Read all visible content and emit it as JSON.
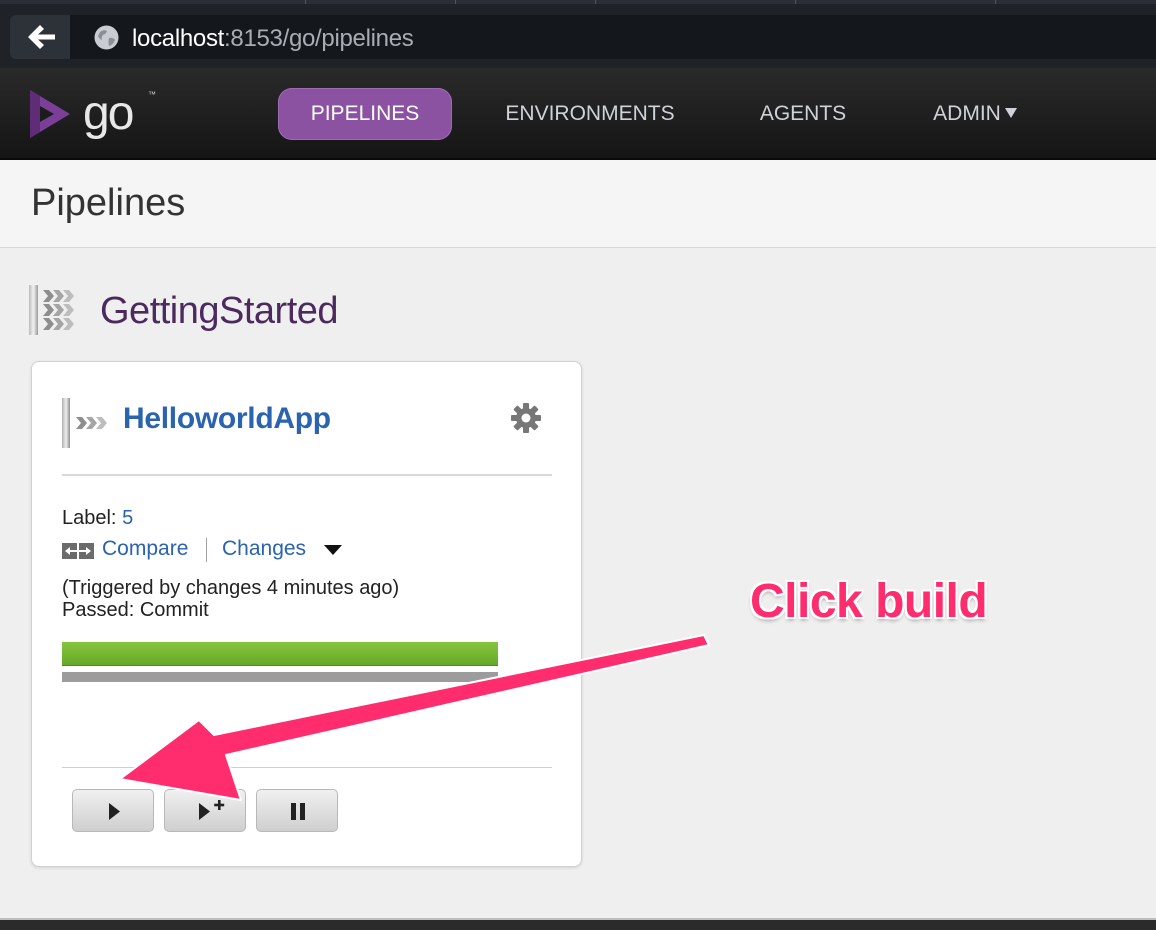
{
  "browser": {
    "url_host": "localhost",
    "url_rest": ":8153/go/pipelines"
  },
  "header": {
    "logo_text": "go",
    "logo_tm": "™",
    "nav": [
      {
        "label": "PIPELINES",
        "active": true
      },
      {
        "label": "ENVIRONMENTS",
        "active": false
      },
      {
        "label": "AGENTS",
        "active": false
      },
      {
        "label": "ADMIN",
        "active": false
      }
    ]
  },
  "page": {
    "title": "Pipelines"
  },
  "group": {
    "name": "GettingStarted",
    "pipeline": {
      "name": "HelloworldApp",
      "label_key": "Label:",
      "label_value": "5",
      "compare_label": "Compare",
      "changes_label": "Changes",
      "triggered_text": "(Triggered by changes 4 minutes ago)",
      "passed_text": "Passed: Commit",
      "stage_status_color": "#74b72e"
    }
  },
  "annotation": {
    "text": "Click build",
    "color": "#ff2c6e"
  }
}
